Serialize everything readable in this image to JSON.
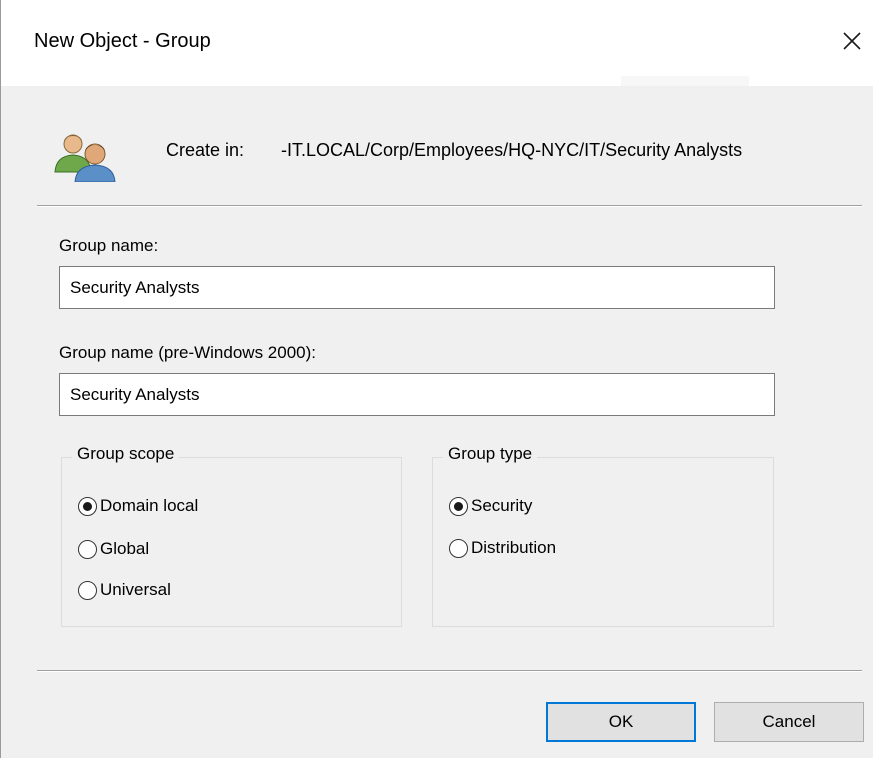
{
  "window": {
    "title": "New Object - Group"
  },
  "header": {
    "create_in_label": "Create in:",
    "create_in_path": "-IT.LOCAL/Corp/Employees/HQ-NYC/IT/Security Analysts",
    "icon": "group-users-icon"
  },
  "form": {
    "group_name_label": "Group name:",
    "group_name_value": "Security Analysts",
    "group_name_pre2000_label": "Group name (pre-Windows 2000):",
    "group_name_pre2000_value": "Security Analysts"
  },
  "group_scope": {
    "legend": "Group scope",
    "options": [
      {
        "label": "Domain local",
        "checked": true
      },
      {
        "label": "Global",
        "checked": false
      },
      {
        "label": "Universal",
        "checked": false
      }
    ]
  },
  "group_type": {
    "legend": "Group type",
    "options": [
      {
        "label": "Security",
        "checked": true
      },
      {
        "label": "Distribution",
        "checked": false
      }
    ]
  },
  "buttons": {
    "ok_label": "OK",
    "cancel_label": "Cancel"
  },
  "colors": {
    "dialog_bg": "#f0f0f0",
    "title_bg": "#ffffff",
    "default_button_border": "#0078d7"
  }
}
